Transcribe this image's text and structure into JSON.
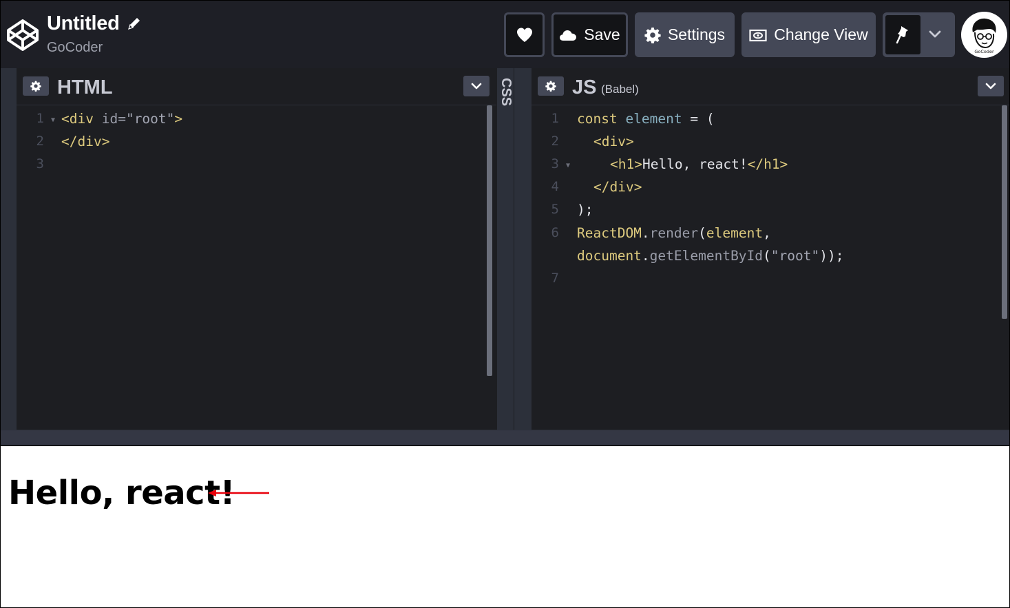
{
  "header": {
    "title": "Untitled",
    "author": "GoCoder",
    "buttons": {
      "save_label": "Save",
      "settings_label": "Settings",
      "change_view_label": "Change View"
    },
    "avatar_text": "GoCoder"
  },
  "editors": {
    "html": {
      "title": "HTML",
      "lines": [
        {
          "num": "1"
        },
        {
          "num": "2"
        },
        {
          "num": "3"
        }
      ],
      "code": {
        "l1_open": "<div",
        "l1_attr": "id=",
        "l1_str": "\"root\"",
        "l1_close": ">",
        "l2": "</div>"
      }
    },
    "css": {
      "title": "CSS"
    },
    "js": {
      "title": "JS",
      "subtitle": "(Babel)",
      "lines": [
        {
          "num": "1"
        },
        {
          "num": "2"
        },
        {
          "num": "3"
        },
        {
          "num": "4"
        },
        {
          "num": "5"
        },
        {
          "num": "6"
        },
        {
          "num": "7"
        }
      ],
      "code": {
        "l1_kw": "const",
        "l1_var": "element",
        "l1_rest": "= (",
        "l2": "<div>",
        "l3_open": "<h1>",
        "l3_text": "Hello, react!",
        "l3_close": "</h1>",
        "l4": "</div>",
        "l5": ");",
        "l6_obj": "ReactDOM",
        "l6_dot": ".",
        "l6_fn": "render",
        "l6_paren": "(",
        "l6_arg": "element",
        "l6_comma": ",",
        "l6b_obj": "document",
        "l6b_dot": ".",
        "l6b_fn": "getElementById",
        "l6b_paren": "(",
        "l6b_str": "\"root\"",
        "l6b_end": "));"
      }
    }
  },
  "preview": {
    "heading": "Hello, react!"
  },
  "colors": {
    "header_bg": "#1e1f26",
    "editor_bg": "#1d1e22",
    "button_bg": "#444857",
    "tag_color": "#ddca7e",
    "annotation_arrow": "#e8000b"
  }
}
